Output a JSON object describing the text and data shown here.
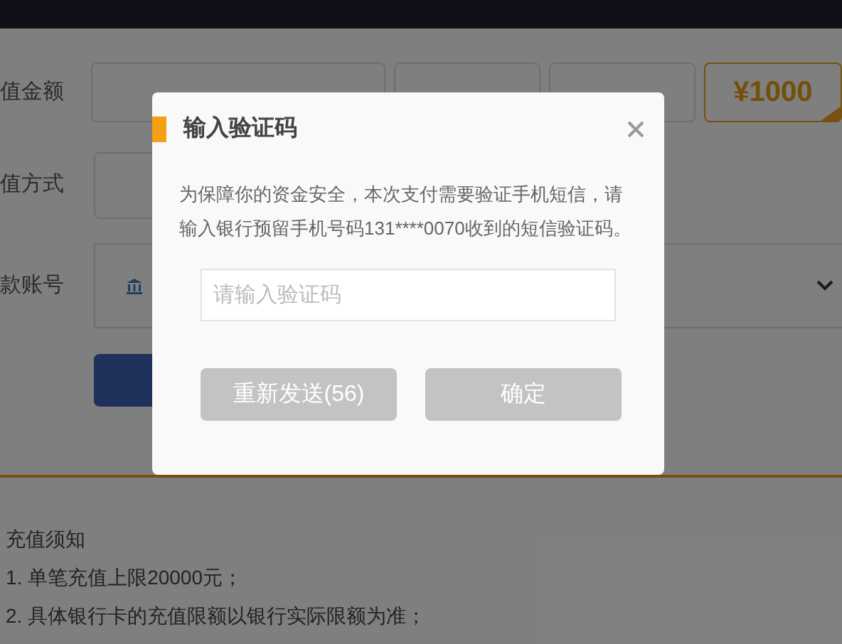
{
  "form": {
    "rows": [
      {
        "kind": "amount",
        "label": "值金额",
        "options": [
          {
            "selected": false
          },
          {
            "selected": false
          },
          {
            "label": "¥1000",
            "selected": true
          }
        ]
      },
      {
        "kind": "method",
        "label": "值方式"
      },
      {
        "kind": "account",
        "label": "款账号"
      }
    ]
  },
  "notice": {
    "title": "充值须知",
    "items": [
      "1. 单笔充值上限20000元；",
      "2. 具体银行卡的充值限额以银行实际限额为准；"
    ]
  },
  "dialog": {
    "title": "输入验证码",
    "message": "为保障你的资金安全，本次支付需要验证手机短信，请输入银行预留手机号码131****0070收到的短信验证码。",
    "placeholder": "请输入验证码",
    "buttons": [
      {
        "label": "重新发送(56)",
        "disabled": true
      },
      {
        "label": "确定",
        "disabled": true
      }
    ]
  }
}
